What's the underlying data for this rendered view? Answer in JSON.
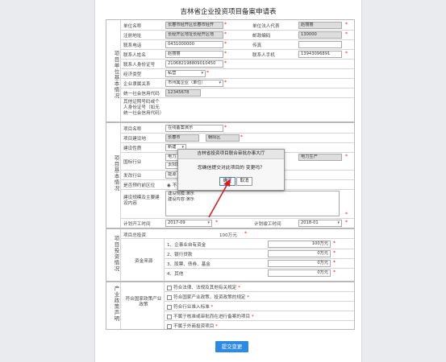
{
  "page": {
    "title": "吉林省企业投资项目备案申请表"
  },
  "sections": {
    "unit": "项目单位基本情况",
    "project": "项目基本情况",
    "invest": "项目投资情况",
    "policy": "产业政策声明"
  },
  "unit": {
    "name_label": "单位名称",
    "name_value": "长春市经开区长春市经开",
    "legal_label": "单位法人代表",
    "legal_value": "赵丽丽",
    "reg_label": "注册地址",
    "reg_value": "长经开区地址长经开区地",
    "post_label": "邮政编码",
    "post_value": "130000",
    "phone_label": "联系电话",
    "phone_value": "0431000000",
    "fax_label": "传真",
    "fax_value": "",
    "contact_label": "联系人姓名",
    "contact_value": "赵丽丽",
    "mobile_label": "联系人手机",
    "mobile_value": "13943096891",
    "idcard_label": "联系人身份证号",
    "idcard_value": "210682198809010450",
    "econ_label": "经济类型",
    "econ_value": "私营",
    "rel_label": "企业隶属关系",
    "rel_value": "市州属企业（单位）",
    "credit_label": "统一社会信用代码",
    "credit_value": "12345678",
    "other_label": "其他证照号码或个人身份证号（如无统一社会信用代码）"
  },
  "project": {
    "name_label": "项目名称",
    "name_value": "在线备案演示",
    "loc_label": "项目建设地",
    "city_value": "长春市",
    "district_value": "朝阳区",
    "nature_label": "建设性质",
    "nature_value": "新建",
    "industry_label": "国标行业",
    "industry_v1": "电力",
    "industry_v2": "太阳能",
    "industry_right": "电力生产",
    "dev_label": "发改行业",
    "dev_value": "能源",
    "pre_label": "是否预约前区位",
    "pre_value": "不",
    "scale_label": "建设规模及主要建设内容",
    "scale_line1": "建设规模:演示",
    "scale_line2": "建设内容:演示",
    "start_label": "计划开工时间",
    "start_value": "2017-09",
    "end_label": "计划竣工时间",
    "end_value": "2018-01"
  },
  "invest": {
    "total_label": "项目总投资",
    "total_value": "100万元",
    "source_label": "资金来源",
    "items": [
      {
        "label": "1、企事业自有资金",
        "value": "100万元"
      },
      {
        "label": "2、银行贷款",
        "value": "0万元"
      },
      {
        "label": "3、股票、债券、基金",
        "value": "0万元"
      },
      {
        "label": "4、其他",
        "value": "0万元"
      }
    ]
  },
  "policy": {
    "label": "符合国家政策产业政策",
    "items": [
      "符合法律、法规及其他有关规定",
      "符合国家产业政策、投资政策的规定",
      "符合行业准入标准",
      "不属于核准或审批而在进行备案的项目",
      "不属于外商投资项目"
    ]
  },
  "dialog": {
    "title": "吉林省投资项目联合审批办事大厅",
    "message": "您确信提交对此项目的 变更吗？",
    "ok": "确定",
    "cancel": "取消"
  },
  "submit": {
    "label": "提交变更"
  },
  "colors": {
    "accent": "#2d8ae0",
    "required": "#dd2222",
    "arrow": "#d62020"
  }
}
